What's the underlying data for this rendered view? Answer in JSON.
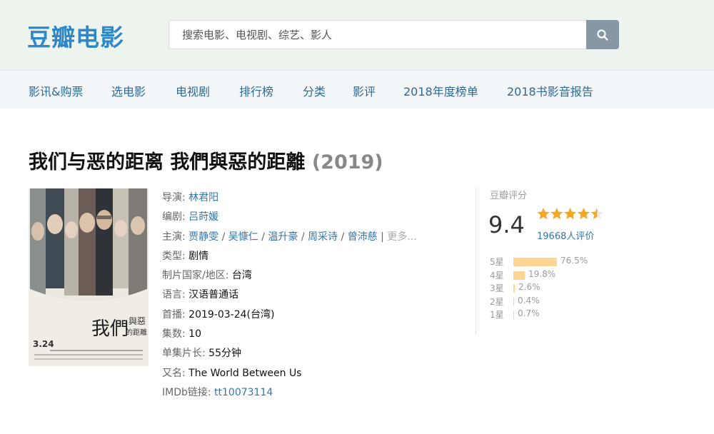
{
  "header": {
    "logo": "豆瓣电影",
    "search_placeholder": "搜索电影、电视剧、综艺、影人"
  },
  "nav": [
    "影讯&购票",
    "选电影",
    "电视剧",
    "排行榜",
    "分类",
    "影评",
    "2018年度榜单",
    "2018书影音报告"
  ],
  "title": {
    "name": "我们与恶的距离 我們與惡的距離",
    "year": "(2019)"
  },
  "poster": {
    "chars_big": "我們",
    "chars_small": "與惡",
    "chars_small2": "的距離",
    "date": "3.24"
  },
  "info": {
    "director_label": "导演",
    "director": "林君阳",
    "writer_label": "编剧",
    "writer": "吕莳媛",
    "cast_label": "主演",
    "cast": [
      "贾静雯",
      "吴慷仁",
      "温升豪",
      "周采诗",
      "曾沛慈"
    ],
    "cast_more": "更多...",
    "genre_label": "类型:",
    "genre": "剧情",
    "country_label": "制片国家/地区:",
    "country": "台湾",
    "language_label": "语言:",
    "language": "汉语普通话",
    "premiere_label": "首播:",
    "premiere": "2019-03-24(台湾)",
    "episodes_label": "集数:",
    "episodes": "10",
    "runtime_label": "单集片长:",
    "runtime": "55分钟",
    "aka_label": "又名:",
    "aka": "The World Between Us",
    "imdb_label": "IMDb链接:",
    "imdb": "tt10073114"
  },
  "rating": {
    "label": "豆瓣评分",
    "score": "9.4",
    "stars": 4.5,
    "votes": "19668人评价",
    "star_color": "#f5a623",
    "bar_color": "#ffd596",
    "distribution": [
      {
        "label": "5星",
        "pct": "76.5%",
        "value": 76.5
      },
      {
        "label": "4星",
        "pct": "19.8%",
        "value": 19.8
      },
      {
        "label": "3星",
        "pct": "2.6%",
        "value": 2.6
      },
      {
        "label": "2星",
        "pct": "0.4%",
        "value": 0.4
      },
      {
        "label": "1星",
        "pct": "0.7%",
        "value": 0.7
      }
    ]
  }
}
